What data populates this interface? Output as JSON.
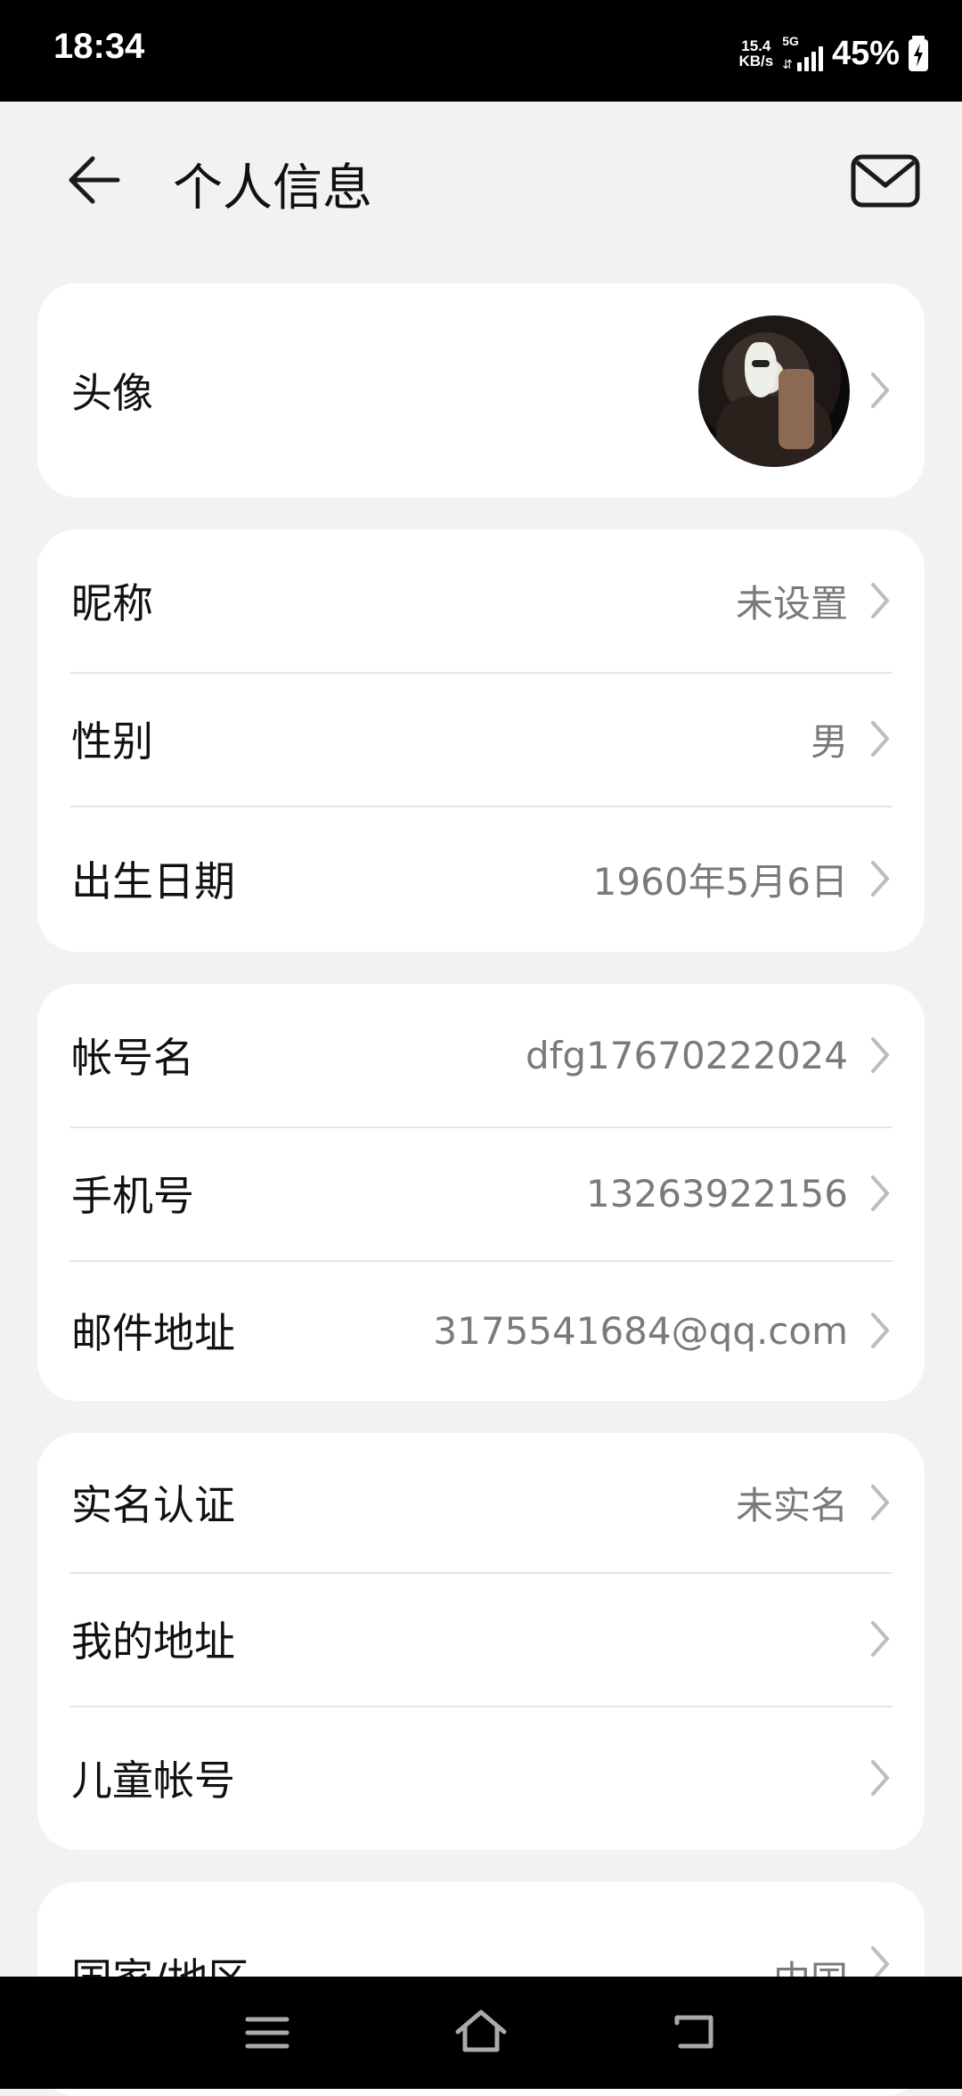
{
  "status_bar": {
    "time": "18:34",
    "net_speed_value": "15.4",
    "net_speed_unit": "KB/s",
    "network_type": "5G",
    "battery_percent": "45%"
  },
  "header": {
    "title": "个人信息",
    "back_icon": "arrow-left-icon",
    "mail_icon": "mail-icon"
  },
  "profile": {
    "avatar_label": "头像"
  },
  "basic_info": [
    {
      "label": "昵称",
      "value": "未设置"
    },
    {
      "label": "性别",
      "value": "男"
    },
    {
      "label": "出生日期",
      "value": "1960年5月6日"
    }
  ],
  "account_info": [
    {
      "label": "帐号名",
      "value": "dfg17670222024"
    },
    {
      "label": "手机号",
      "value": "13263922156"
    },
    {
      "label": "邮件地址",
      "value": "3175541684@qq.com"
    }
  ],
  "other_info": [
    {
      "label": "实名认证",
      "value": "未实名"
    },
    {
      "label": "我的地址",
      "value": ""
    },
    {
      "label": "儿童帐号",
      "value": ""
    }
  ],
  "region_info": [
    {
      "label": "国家/地区",
      "value": "中国"
    }
  ],
  "colors": {
    "background": "#f1f2f4",
    "card": "#ffffff",
    "value_text": "#7a7a7a"
  }
}
